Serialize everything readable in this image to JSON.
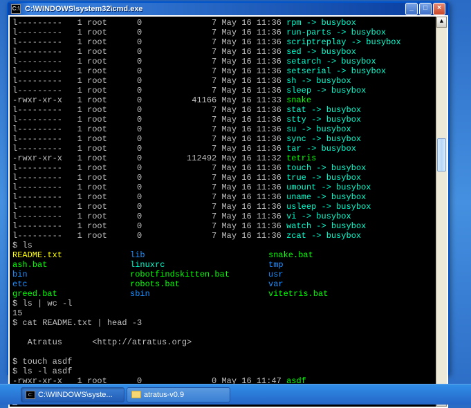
{
  "window": {
    "title": "C:\\WINDOWS\\system32\\cmd.exe",
    "icon_glyph": "C:\\"
  },
  "title_buttons": {
    "minimize": "_",
    "maximize": "□",
    "close": "×"
  },
  "listing": [
    {
      "perm": "l---------",
      "links": "1",
      "owner": "root",
      "size": "0",
      "fsize": "7",
      "date": "May 16 11:36",
      "name": "rpm",
      "link": " -> busybox"
    },
    {
      "perm": "l---------",
      "links": "1",
      "owner": "root",
      "size": "0",
      "fsize": "7",
      "date": "May 16 11:36",
      "name": "run-parts",
      "link": " -> busybox"
    },
    {
      "perm": "l---------",
      "links": "1",
      "owner": "root",
      "size": "0",
      "fsize": "7",
      "date": "May 16 11:36",
      "name": "scriptreplay",
      "link": " -> busybox"
    },
    {
      "perm": "l---------",
      "links": "1",
      "owner": "root",
      "size": "0",
      "fsize": "7",
      "date": "May 16 11:36",
      "name": "sed",
      "link": " -> busybox"
    },
    {
      "perm": "l---------",
      "links": "1",
      "owner": "root",
      "size": "0",
      "fsize": "7",
      "date": "May 16 11:36",
      "name": "setarch",
      "link": " -> busybox"
    },
    {
      "perm": "l---------",
      "links": "1",
      "owner": "root",
      "size": "0",
      "fsize": "7",
      "date": "May 16 11:36",
      "name": "setserial",
      "link": " -> busybox"
    },
    {
      "perm": "l---------",
      "links": "1",
      "owner": "root",
      "size": "0",
      "fsize": "7",
      "date": "May 16 11:36",
      "name": "sh",
      "link": " -> busybox"
    },
    {
      "perm": "l---------",
      "links": "1",
      "owner": "root",
      "size": "0",
      "fsize": "7",
      "date": "May 16 11:36",
      "name": "sleep",
      "link": " -> busybox"
    },
    {
      "perm": "-rwxr-xr-x",
      "links": "1",
      "owner": "root",
      "size": "0",
      "fsize": "41166",
      "date": "May 16 11:33",
      "name": "snake",
      "link": "",
      "exec": true
    },
    {
      "perm": "l---------",
      "links": "1",
      "owner": "root",
      "size": "0",
      "fsize": "7",
      "date": "May 16 11:36",
      "name": "stat",
      "link": " -> busybox"
    },
    {
      "perm": "l---------",
      "links": "1",
      "owner": "root",
      "size": "0",
      "fsize": "7",
      "date": "May 16 11:36",
      "name": "stty",
      "link": " -> busybox"
    },
    {
      "perm": "l---------",
      "links": "1",
      "owner": "root",
      "size": "0",
      "fsize": "7",
      "date": "May 16 11:36",
      "name": "su",
      "link": " -> busybox"
    },
    {
      "perm": "l---------",
      "links": "1",
      "owner": "root",
      "size": "0",
      "fsize": "7",
      "date": "May 16 11:36",
      "name": "sync",
      "link": " -> busybox"
    },
    {
      "perm": "l---------",
      "links": "1",
      "owner": "root",
      "size": "0",
      "fsize": "7",
      "date": "May 16 11:36",
      "name": "tar",
      "link": " -> busybox"
    },
    {
      "perm": "-rwxr-xr-x",
      "links": "1",
      "owner": "root",
      "size": "0",
      "fsize": "112492",
      "date": "May 16 11:32",
      "name": "tetris",
      "link": "",
      "exec": true
    },
    {
      "perm": "l---------",
      "links": "1",
      "owner": "root",
      "size": "0",
      "fsize": "7",
      "date": "May 16 11:36",
      "name": "touch",
      "link": " -> busybox"
    },
    {
      "perm": "l---------",
      "links": "1",
      "owner": "root",
      "size": "0",
      "fsize": "7",
      "date": "May 16 11:36",
      "name": "true",
      "link": " -> busybox"
    },
    {
      "perm": "l---------",
      "links": "1",
      "owner": "root",
      "size": "0",
      "fsize": "7",
      "date": "May 16 11:36",
      "name": "umount",
      "link": " -> busybox"
    },
    {
      "perm": "l---------",
      "links": "1",
      "owner": "root",
      "size": "0",
      "fsize": "7",
      "date": "May 16 11:36",
      "name": "uname",
      "link": " -> busybox"
    },
    {
      "perm": "l---------",
      "links": "1",
      "owner": "root",
      "size": "0",
      "fsize": "7",
      "date": "May 16 11:36",
      "name": "usleep",
      "link": " -> busybox"
    },
    {
      "perm": "l---------",
      "links": "1",
      "owner": "root",
      "size": "0",
      "fsize": "7",
      "date": "May 16 11:36",
      "name": "vi",
      "link": " -> busybox"
    },
    {
      "perm": "l---------",
      "links": "1",
      "owner": "root",
      "size": "0",
      "fsize": "7",
      "date": "May 16 11:36",
      "name": "watch",
      "link": " -> busybox"
    },
    {
      "perm": "l---------",
      "links": "1",
      "owner": "root",
      "size": "0",
      "fsize": "7",
      "date": "May 16 11:36",
      "name": "zcat",
      "link": " -> busybox"
    }
  ],
  "commands": {
    "cmd1": "$ ls",
    "cmd2": "$ ls | wc -l",
    "cmd2_out": "15",
    "cmd3": "$ cat README.txt | head -3",
    "cmd4": "$ touch asdf",
    "cmd5": "$ ls -l asdf",
    "prompt": "$"
  },
  "ls_output": [
    [
      {
        "t": "README.txt",
        "c": "y"
      },
      {
        "t": "lib",
        "c": "b"
      },
      {
        "t": "snake.bat",
        "c": "g"
      }
    ],
    [
      {
        "t": "ash.bat",
        "c": "g"
      },
      {
        "t": "linuxrc",
        "c": "c"
      },
      {
        "t": "tmp",
        "c": "b"
      }
    ],
    [
      {
        "t": "bin",
        "c": "b"
      },
      {
        "t": "robotfindskitten.bat",
        "c": "g"
      },
      {
        "t": "usr",
        "c": "b"
      }
    ],
    [
      {
        "t": "etc",
        "c": "b"
      },
      {
        "t": "robots.bat",
        "c": "g"
      },
      {
        "t": "var",
        "c": "b"
      }
    ],
    [
      {
        "t": "greed.bat",
        "c": "g"
      },
      {
        "t": "sbin",
        "c": "b"
      },
      {
        "t": "vitetris.bat",
        "c": "g"
      }
    ]
  ],
  "readme": {
    "line1": "   Atratus      <http://atratus.org>"
  },
  "asdf_line": {
    "perm": "-rwxr-xr-x",
    "links": "1",
    "owner": "root",
    "size": "0",
    "fsize": "0",
    "date": "May 16 11:47",
    "name": "asdf"
  },
  "taskbar": {
    "item1": "C:\\WINDOWS\\syste...",
    "item2": "atratus-v0.9"
  }
}
